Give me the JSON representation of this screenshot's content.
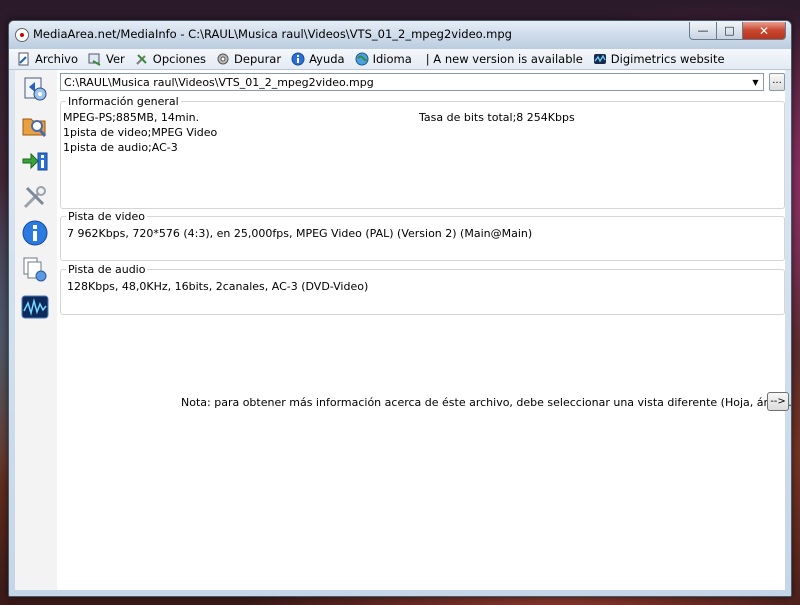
{
  "window": {
    "title": "MediaArea.net/MediaInfo - C:\\RAUL\\Musica raul\\Videos\\VTS_01_2_mpeg2video.mpg",
    "minimize": "—",
    "maximize": "□",
    "close": "✕"
  },
  "menu": {
    "archivo": "Archivo",
    "ver": "Ver",
    "opciones": "Opciones",
    "depurar": "Depurar",
    "ayuda": "Ayuda",
    "idioma": "Idioma",
    "new_version": "| A new version is available",
    "digimetrics": "Digimetrics website"
  },
  "file": {
    "path": "C:\\RAUL\\Musica raul\\Videos\\VTS_01_2_mpeg2video.mpg",
    "browse_label": "..."
  },
  "general": {
    "title": "Información general",
    "line1": "MPEG-PS;885MB, 14min.",
    "bitrate": "Tasa de bits total;8 254Kbps",
    "line2": "1pista de video;MPEG Video",
    "line3": "1pista de audio;AC-3"
  },
  "video": {
    "title": "Pista de video",
    "line1": "7 962Kbps, 720*576 (4:3), en 25,000fps, MPEG Video (PAL) (Version 2) (Main@Main)"
  },
  "audio": {
    "title": "Pista de audio",
    "line1": "128Kbps, 48,0KHz, 16bits, 2canales, AC-3 (DVD-Video)"
  },
  "note": {
    "text": "Nota: para obtener más información acerca de éste archivo, debe seleccionar una vista diferente (Hoja, árbol ...)",
    "button": "-->"
  },
  "colors": {
    "accent": "#1f5fb3",
    "close": "#c8452e"
  }
}
